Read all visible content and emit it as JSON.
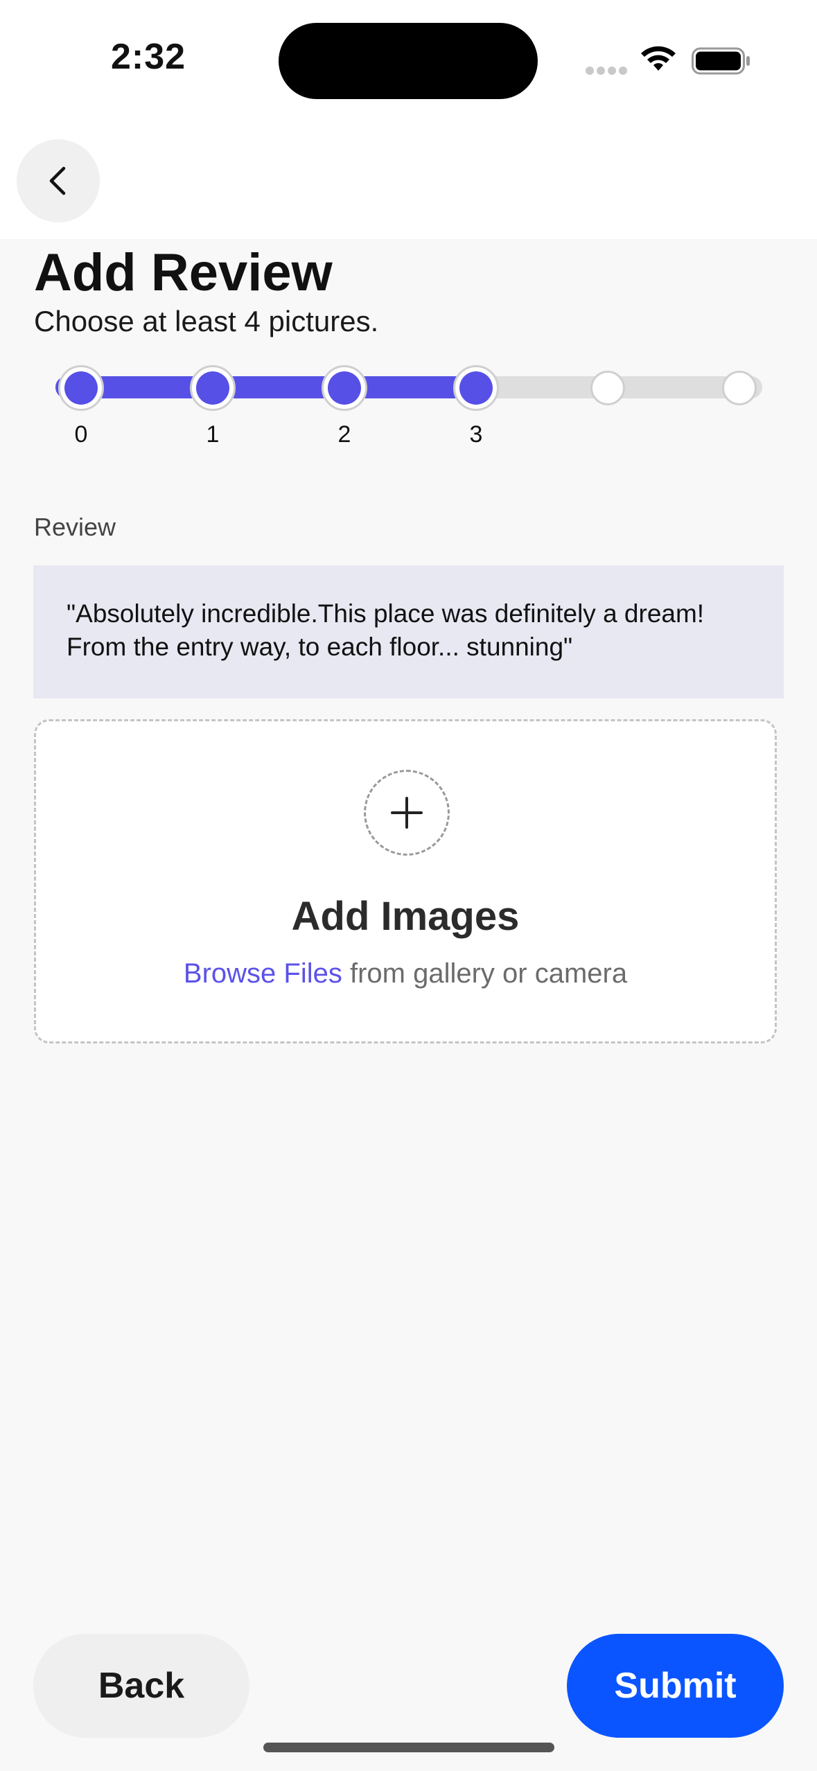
{
  "status_bar": {
    "time": "2:32"
  },
  "nav": {
    "back_icon": "chevron-left-icon"
  },
  "header": {
    "title": "Add Review",
    "subtitle": "Choose at least 4 pictures."
  },
  "stepper": {
    "progress_fraction": 0.6,
    "steps": [
      {
        "label": "0",
        "filled": true
      },
      {
        "label": "1",
        "filled": true
      },
      {
        "label": "2",
        "filled": true
      },
      {
        "label": "3",
        "filled": true
      },
      {
        "label": "",
        "filled": false
      },
      {
        "label": "",
        "filled": false
      }
    ]
  },
  "review": {
    "label": "Review",
    "text": "\"Absolutely incredible.This place was definitely a dream! From the entry way, to each floor... stunning\""
  },
  "upload": {
    "icon": "plus-icon",
    "title": "Add Images",
    "browse_label": "Browse Files",
    "suffix": " from gallery or camera"
  },
  "footer": {
    "back_label": "Back",
    "submit_label": "Submit"
  },
  "colors": {
    "accent": "#5650e6",
    "primary_button": "#0a55ff",
    "review_bg": "#e8e8f2"
  }
}
